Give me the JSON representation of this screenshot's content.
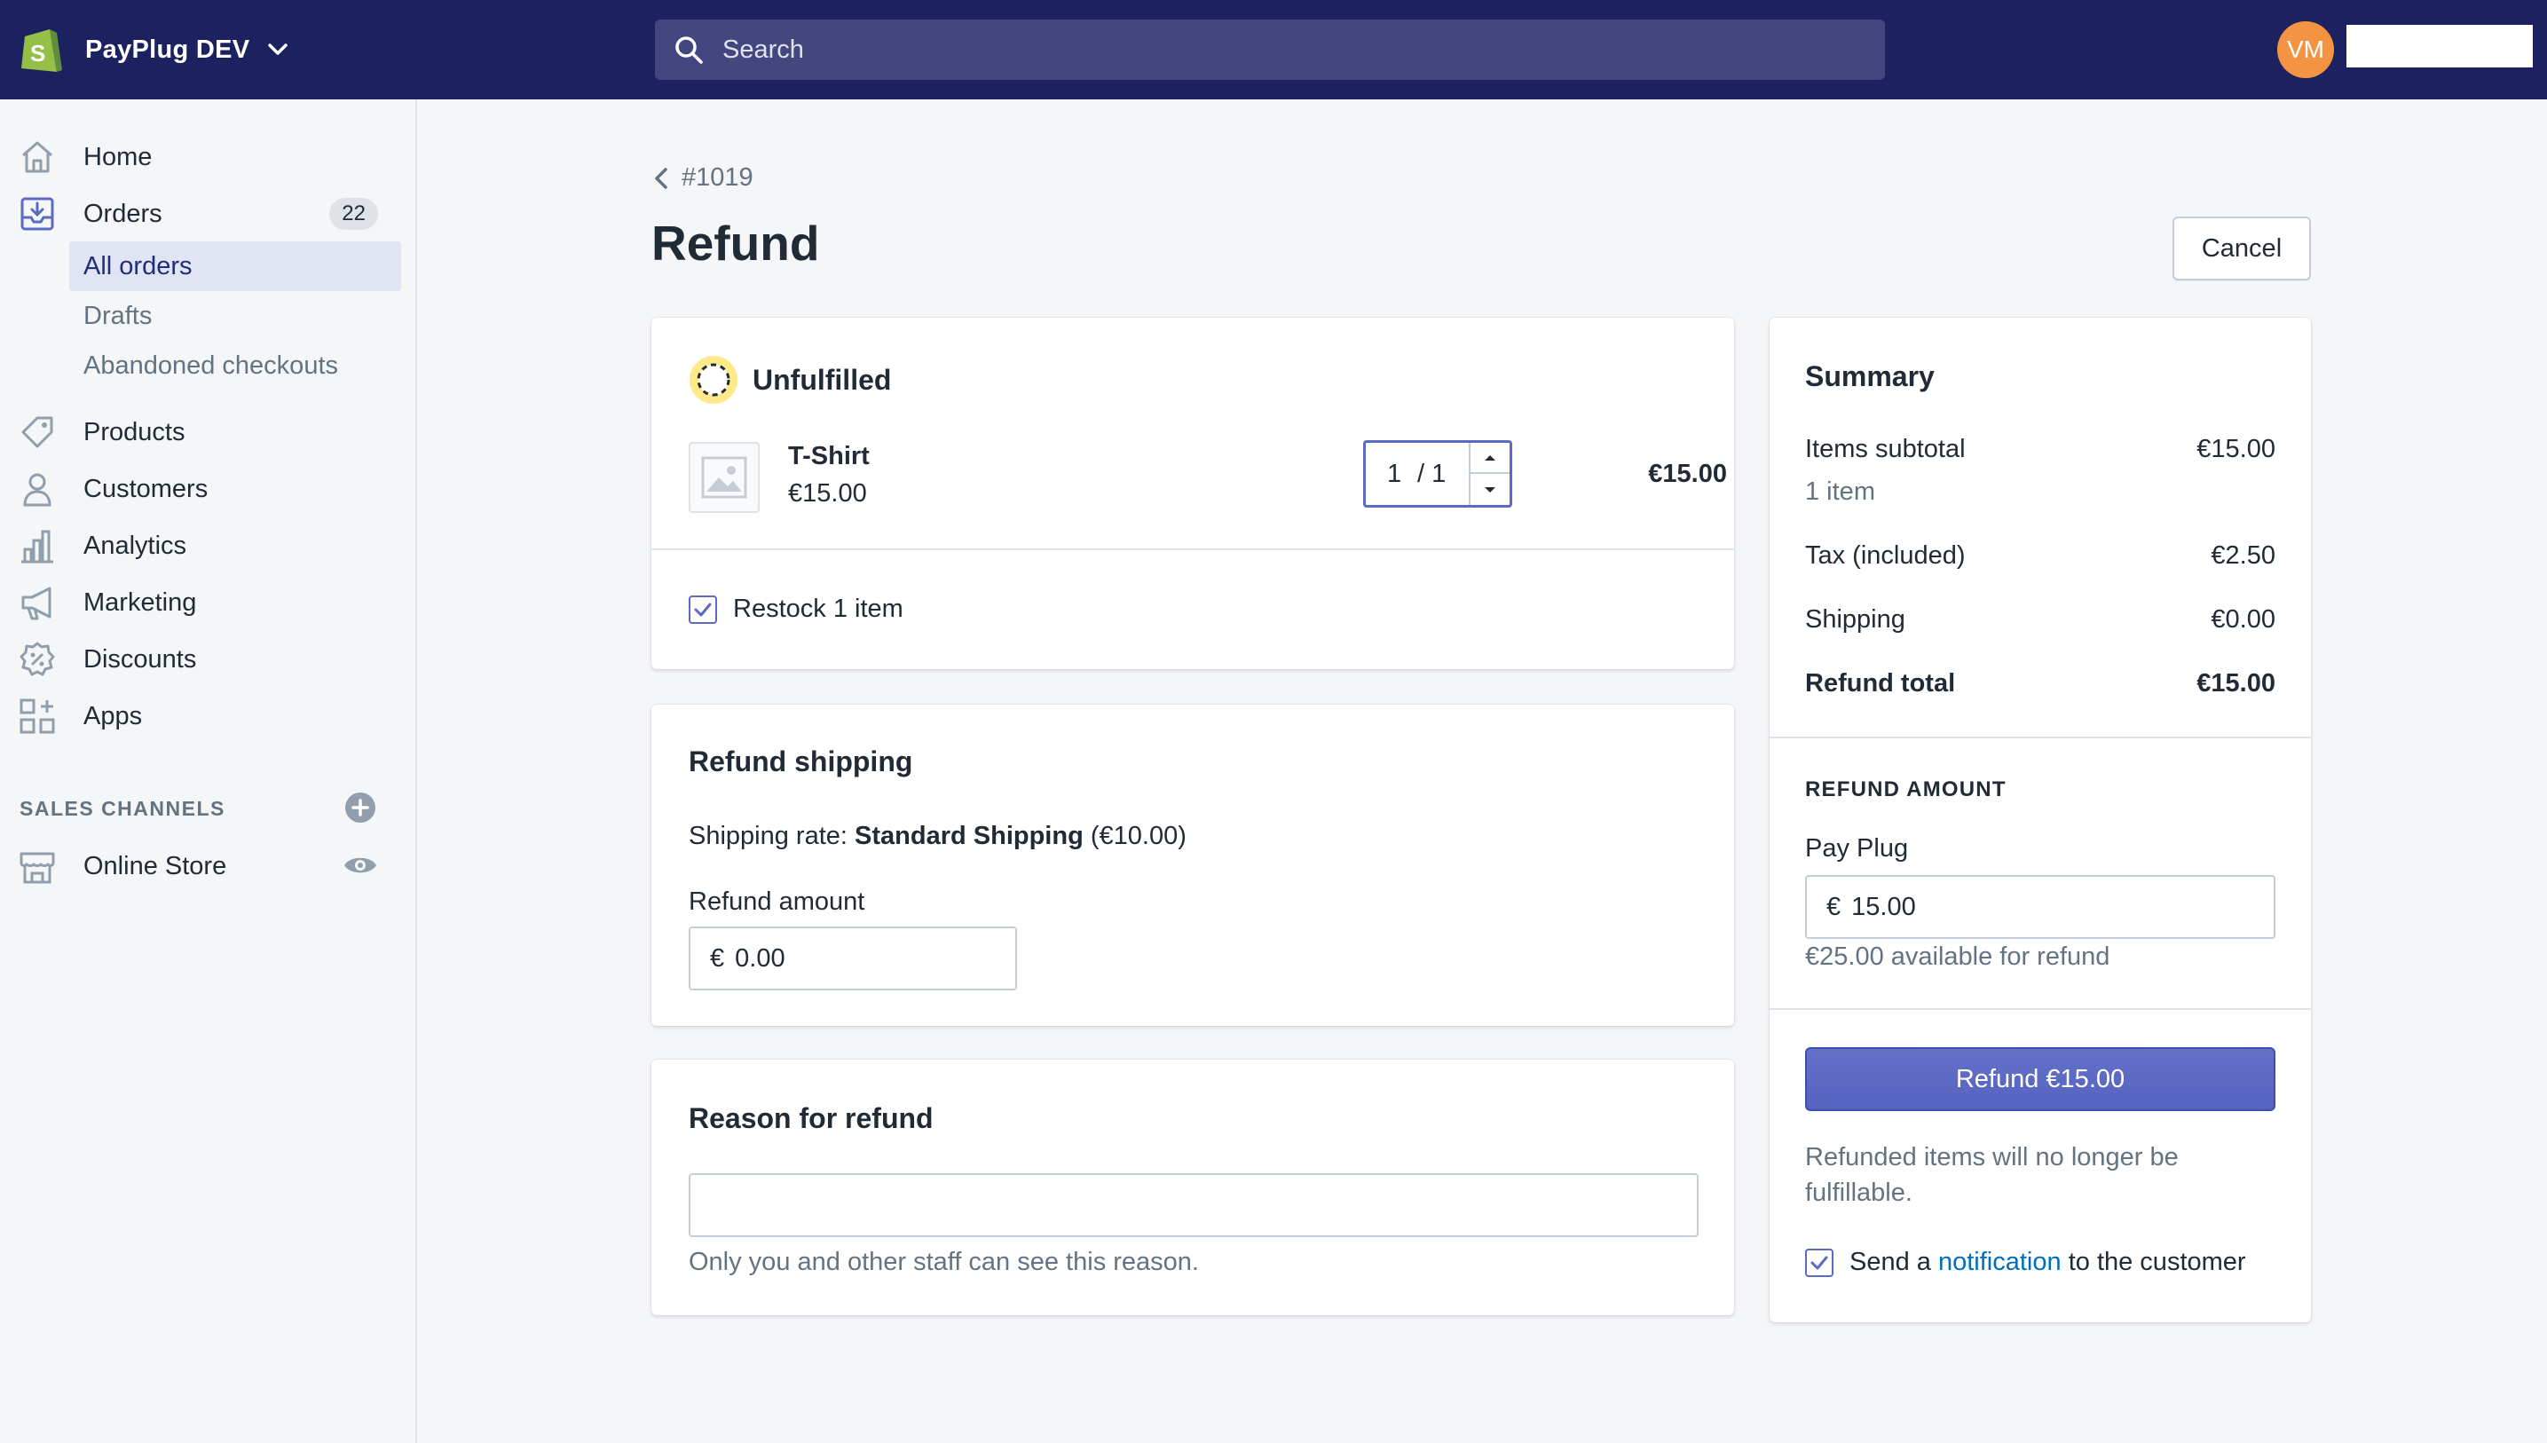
{
  "topbar": {
    "store_name": "PayPlug DEV",
    "search_placeholder": "Search",
    "avatar_initials": "VM"
  },
  "sidebar": {
    "items": [
      {
        "label": "Home",
        "icon": "home-icon"
      },
      {
        "label": "Orders",
        "icon": "orders-icon",
        "badge": "22"
      },
      {
        "label": "Products",
        "icon": "tag-icon"
      },
      {
        "label": "Customers",
        "icon": "customer-icon"
      },
      {
        "label": "Analytics",
        "icon": "analytics-icon"
      },
      {
        "label": "Marketing",
        "icon": "megaphone-icon"
      },
      {
        "label": "Discounts",
        "icon": "discount-icon"
      },
      {
        "label": "Apps",
        "icon": "apps-icon"
      }
    ],
    "orders_sub": [
      "All orders",
      "Drafts",
      "Abandoned checkouts"
    ],
    "sales_channels_label": "SALES CHANNELS",
    "online_store": "Online Store"
  },
  "page": {
    "back_label": "#1019",
    "title": "Refund",
    "cancel_label": "Cancel"
  },
  "unfulfilled": {
    "title": "Unfulfilled",
    "product_name": "T-Shirt",
    "product_price": "€15.00",
    "qty_value": "1",
    "qty_total": "/ 1",
    "line_total": "€15.00",
    "restock_label": "Restock 1 item",
    "restock_checked": true
  },
  "shipping": {
    "title": "Refund shipping",
    "rate_prefix": "Shipping rate: ",
    "rate_name": "Standard Shipping",
    "rate_amount": " (€10.00)",
    "amount_label": "Refund amount",
    "currency": "€",
    "amount_value": "0.00"
  },
  "reason": {
    "title": "Reason for refund",
    "value": "",
    "help": "Only you and other staff can see this reason."
  },
  "summary": {
    "title": "Summary",
    "items_subtotal_label": "Items subtotal",
    "items_subtotal_value": "€15.00",
    "items_count": "1 item",
    "tax_label": "Tax (included)",
    "tax_value": "€2.50",
    "shipping_label": "Shipping",
    "shipping_value": "€0.00",
    "total_label": "Refund total",
    "total_value": "€15.00",
    "refund_amount_heading": "REFUND AMOUNT",
    "gateway": "Pay Plug",
    "currency": "€",
    "gateway_amount": "15.00",
    "available": "€25.00 available for refund",
    "refund_button": "Refund €15.00",
    "note": "Refunded items will no longer be fulfillable.",
    "notify_prefix": "Send a ",
    "notify_link": "notification",
    "notify_suffix": " to the customer",
    "notify_checked": true
  },
  "colors": {
    "topbar": "#1c2260",
    "primary": "#5c6ac4",
    "link": "#006fbb",
    "avatar": "#f49342"
  }
}
